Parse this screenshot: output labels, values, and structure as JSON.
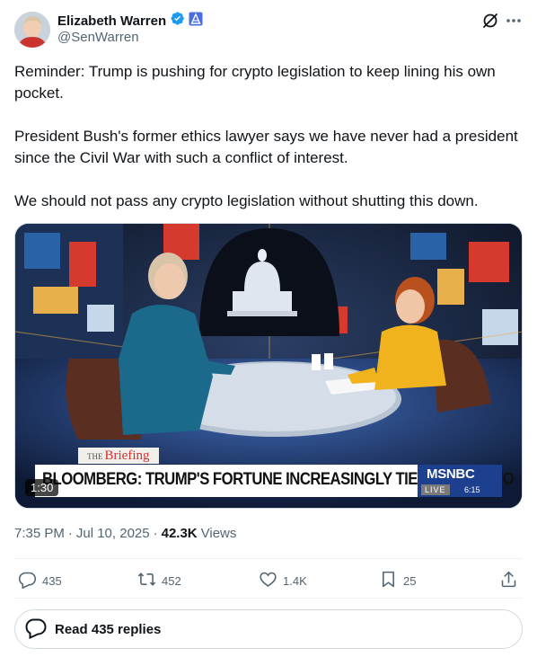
{
  "author": {
    "display_name": "Elizabeth Warren",
    "handle": "@SenWarren"
  },
  "icons": {
    "verified": "verified-badge-icon",
    "government": "government-affiliation-icon",
    "grok": "grok-icon",
    "more": "more-icon",
    "reply": "reply-icon",
    "retweet": "retweet-icon",
    "like": "like-icon",
    "bookmark": "bookmark-icon",
    "share": "share-icon"
  },
  "colors": {
    "verified": "#1d9bf0",
    "secondary_text": "#536471",
    "primary_text": "#0f1419"
  },
  "post": {
    "paragraphs": [
      "Reminder: Trump is pushing for crypto legislation to keep lining his own pocket.",
      "President Bush's former ethics lawyer says we have never had a president since the Civil War with such a conflict of interest.",
      "We should not pass any crypto legislation without shutting this down."
    ]
  },
  "video": {
    "duration": "1:30",
    "show_tag_prefix": "THE",
    "show_tag_name": "Briefing",
    "chyron": "BLOOMBERG: TRUMP'S FORTUNE INCREASINGLY TIED TO CRYPTO",
    "network": "MSNBC",
    "live_label": "LIVE",
    "live_time": "6:15"
  },
  "meta": {
    "time": "7:35 PM",
    "date": "Jul 10, 2025",
    "views_count": "42.3K",
    "views_label": "Views"
  },
  "actions": {
    "replies": "435",
    "reposts": "452",
    "likes": "1.4K",
    "bookmarks": "25"
  },
  "read_replies_label": "Read 435 replies"
}
